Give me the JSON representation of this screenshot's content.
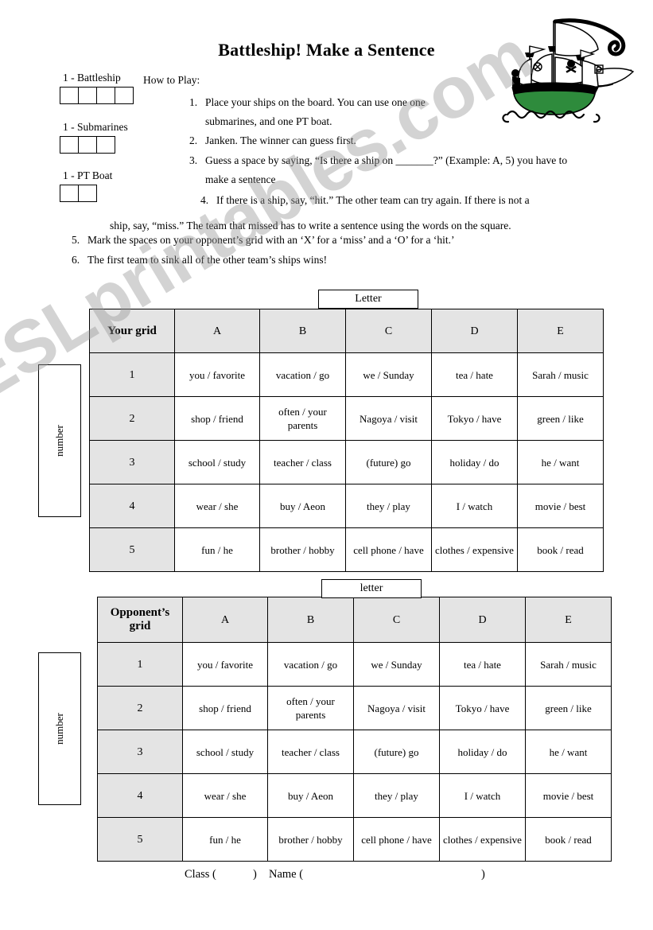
{
  "watermark": "ESLprintables.com",
  "title": "Battleship! Make a Sentence",
  "ship_art": "pirate-galleon-illustration",
  "ships": [
    {
      "label": "1 - Battleship",
      "cells": 4
    },
    {
      "label": "1 - Submarines",
      "cells": 3
    },
    {
      "label": "1 - PT Boat",
      "cells": 2
    }
  ],
  "howto": {
    "heading": "How to Play:",
    "steps": [
      {
        "num": "1.",
        "text": "Place your ships on the board. You can use one one submarines, and one PT boat."
      },
      {
        "num": "2.",
        "text": "Janken. The winner can guess first."
      },
      {
        "num": "3.",
        "text": "Guess a space by saying, “Is there a ship on _______?” (Example: A, 5) you have to make a sentence"
      },
      {
        "num": "4.",
        "text": "If there is a ship, say, “hit.” The other team can try again. If there is not a"
      },
      {
        "num": "",
        "text": "ship, say, “miss.” The team that missed has to write a sentence using the words on the square."
      },
      {
        "num": "5.",
        "text": "Mark the spaces on your opponent’s grid with an ‘X’ for a ‘miss’ and a ‘O’ for a ‘hit.’"
      },
      {
        "num": "6.",
        "text": "The first team to sink all of the other team’s ships wins!"
      }
    ]
  },
  "grids": [
    {
      "axis_label_top": "Letter",
      "axis_label_side": "number",
      "corner": "Your grid",
      "columns": [
        "A",
        "B",
        "C",
        "D",
        "E"
      ],
      "rows": [
        {
          "head": "1",
          "cells": [
            "you / favorite",
            "vacation / go",
            "we / Sunday",
            "tea / hate",
            "Sarah / music"
          ]
        },
        {
          "head": "2",
          "cells": [
            "shop / friend",
            "often / your parents",
            "Nagoya / visit",
            "Tokyo / have",
            "green / like"
          ]
        },
        {
          "head": "3",
          "cells": [
            "school / study",
            "teacher / class",
            "(future) go",
            "holiday / do",
            "he / want"
          ]
        },
        {
          "head": "4",
          "cells": [
            "wear / she",
            "buy / Aeon",
            "they / play",
            "I / watch",
            "movie / best"
          ]
        },
        {
          "head": "5",
          "cells": [
            "fun / he",
            "brother / hobby",
            "cell phone / have",
            "clothes / expensive",
            "book / read"
          ]
        }
      ]
    },
    {
      "axis_label_top": "letter",
      "axis_label_side": "number",
      "corner": "Opponent’s grid",
      "columns": [
        "A",
        "B",
        "C",
        "D",
        "E"
      ],
      "rows": [
        {
          "head": "1",
          "cells": [
            "you / favorite",
            "vacation / go",
            "we / Sunday",
            "tea / hate",
            "Sarah / music"
          ]
        },
        {
          "head": "2",
          "cells": [
            "shop / friend",
            "often / your parents",
            "Nagoya / visit",
            "Tokyo / have",
            "green / like"
          ]
        },
        {
          "head": "3",
          "cells": [
            "school / study",
            "teacher / class",
            "(future) go",
            "holiday / do",
            "he / want"
          ]
        },
        {
          "head": "4",
          "cells": [
            "wear / she",
            "buy / Aeon",
            "they / play",
            "I / watch",
            "movie / best"
          ]
        },
        {
          "head": "5",
          "cells": [
            "fun / he",
            "brother / hobby",
            "cell phone / have",
            "clothes / expensive",
            "book / read"
          ]
        }
      ]
    }
  ],
  "footer": {
    "class_field": "Class (",
    "class_close": ")",
    "name_field": "Name (",
    "name_close": ")"
  },
  "colors": {
    "header_fill": "#e4e4e4",
    "ship_hull": "#2e8b3c",
    "line": "#000000",
    "watermark": "#969696"
  }
}
